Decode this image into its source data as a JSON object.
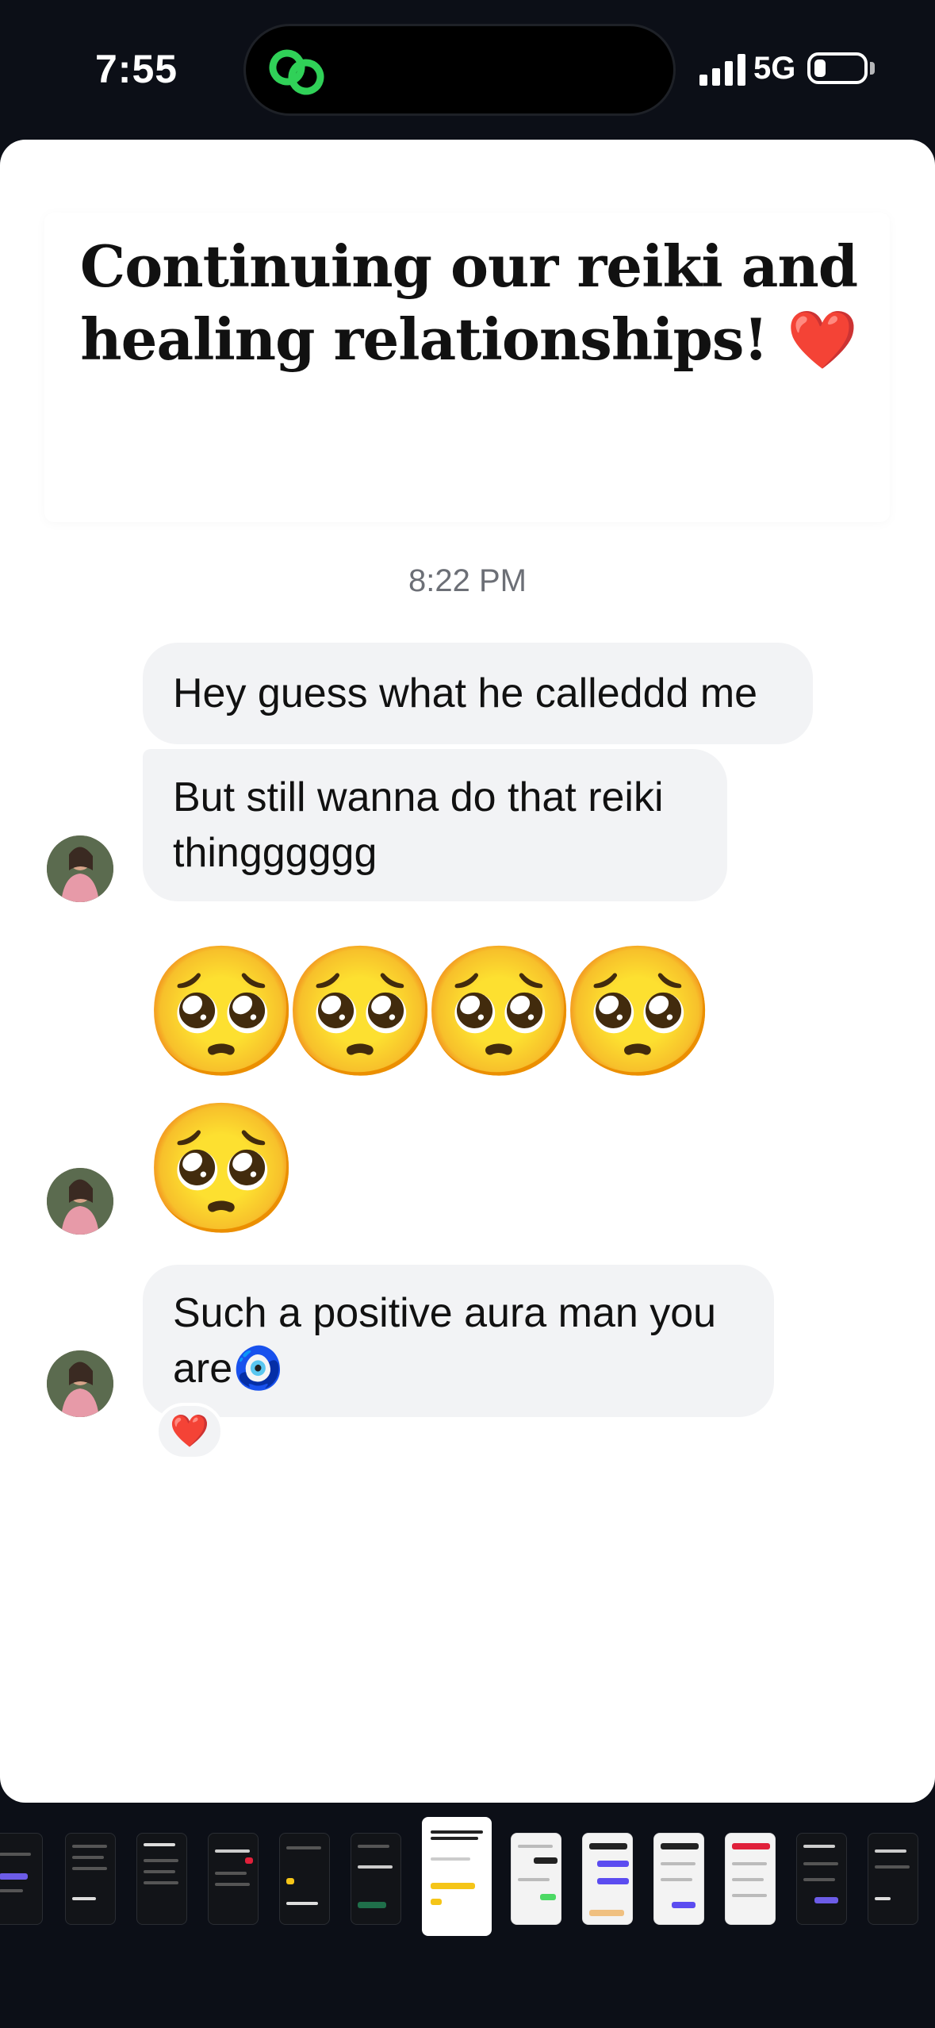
{
  "status_bar": {
    "time": "7:55",
    "network": "5G",
    "app_icon": "link-icon",
    "accent_color": "#30d158"
  },
  "post": {
    "title": "Continuing our reiki and healing relationships! ❤️",
    "timestamp": "8:22 PM",
    "messages": [
      {
        "text": "Hey guess what he calleddd me"
      },
      {
        "text": "But still wanna do that reiki thingggggg"
      },
      {
        "emojis": [
          "🥺",
          "🥺",
          "🥺",
          "🥺"
        ]
      },
      {
        "emojis": [
          "🥺"
        ]
      },
      {
        "text": "Such a positive aura man you are🧿",
        "reaction": "❤️"
      }
    ]
  },
  "thumbnails": {
    "count": 13,
    "active_index": 6
  }
}
